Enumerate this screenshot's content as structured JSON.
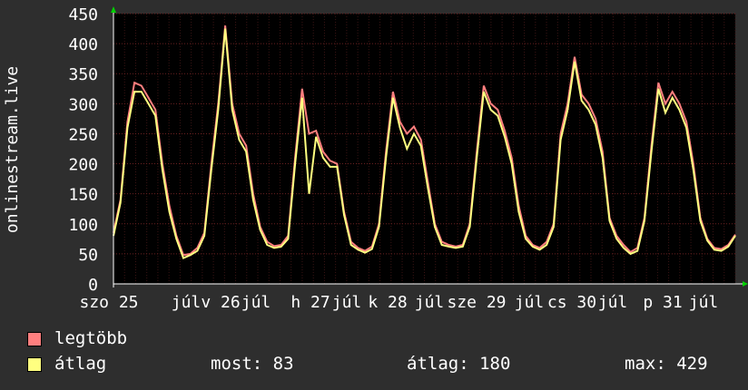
{
  "chart_data": {
    "type": "line",
    "ylabel": "onlinestream.live",
    "ylim": [
      0,
      450
    ],
    "yticks": [
      0,
      50,
      100,
      150,
      200,
      250,
      300,
      350,
      400,
      450
    ],
    "xticks": [
      "szo 25",
      "júl",
      "v 26",
      "júl",
      "h 27",
      "júl",
      "k 28",
      "júl",
      "sze 29",
      "júl",
      "cs 30",
      "júl",
      "p 31",
      "júl"
    ],
    "grid": true,
    "series": [
      {
        "name": "legtöbb",
        "color": "#ff7f7f",
        "values": [
          85,
          140,
          270,
          335,
          330,
          310,
          290,
          200,
          130,
          80,
          48,
          50,
          60,
          85,
          200,
          300,
          430,
          300,
          250,
          230,
          150,
          95,
          70,
          63,
          65,
          80,
          210,
          325,
          250,
          255,
          220,
          205,
          200,
          120,
          70,
          60,
          55,
          62,
          100,
          220,
          320,
          270,
          250,
          262,
          240,
          170,
          100,
          70,
          65,
          62,
          65,
          100,
          220,
          330,
          300,
          290,
          255,
          210,
          130,
          80,
          65,
          60,
          70,
          100,
          250,
          300,
          378,
          315,
          300,
          275,
          220,
          110,
          80,
          65,
          53,
          60,
          110,
          230,
          335,
          300,
          320,
          300,
          270,
          200,
          110,
          75,
          60,
          58,
          65,
          82
        ]
      },
      {
        "name": "átlag",
        "color": "#ffff80",
        "values": [
          80,
          135,
          260,
          320,
          320,
          300,
          280,
          190,
          120,
          75,
          43,
          48,
          55,
          80,
          190,
          290,
          425,
          290,
          240,
          220,
          140,
          90,
          65,
          60,
          62,
          75,
          200,
          310,
          150,
          245,
          210,
          195,
          195,
          115,
          65,
          57,
          52,
          58,
          95,
          210,
          310,
          260,
          225,
          250,
          230,
          160,
          95,
          65,
          62,
          60,
          62,
          95,
          210,
          320,
          290,
          280,
          245,
          200,
          120,
          75,
          62,
          57,
          65,
          95,
          240,
          290,
          370,
          305,
          290,
          265,
          210,
          105,
          75,
          60,
          50,
          55,
          105,
          220,
          325,
          285,
          310,
          290,
          260,
          190,
          105,
          72,
          57,
          55,
          62,
          80
        ]
      }
    ]
  },
  "legend": {
    "max_label": "legtöbb",
    "avg_label": "átlag"
  },
  "stats": {
    "current": "most: 83",
    "average": "átlag: 180",
    "maximum": "max: 429"
  },
  "colors": {
    "background": "#2e2e2e",
    "plot_bg": "#000000",
    "grid": "#5a1a1a",
    "axis": "#00d000",
    "max": "#ff7f7f",
    "avg": "#ffff80"
  }
}
